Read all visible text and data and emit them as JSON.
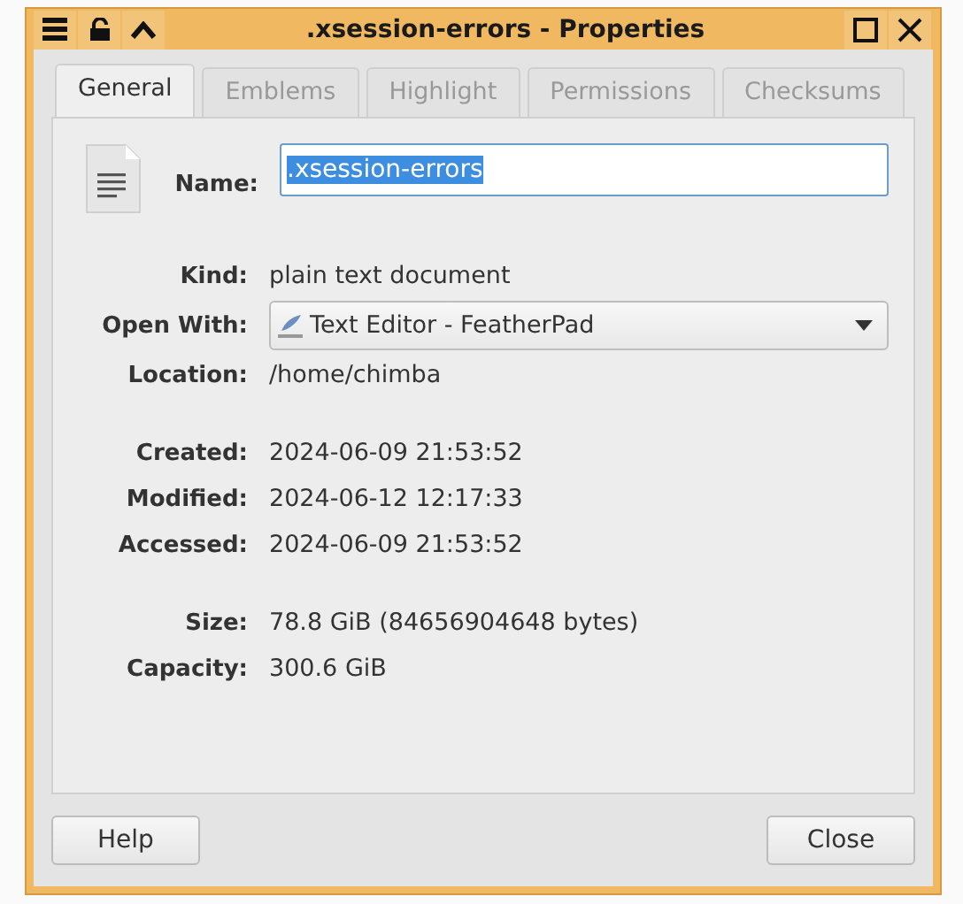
{
  "window": {
    "title": ".xsession-errors - Properties"
  },
  "tabs": [
    {
      "label": "General",
      "selected": true
    },
    {
      "label": "Emblems",
      "selected": false
    },
    {
      "label": "Highlight",
      "selected": false
    },
    {
      "label": "Permissions",
      "selected": false
    },
    {
      "label": "Checksums",
      "selected": false
    }
  ],
  "name_field": {
    "label": "Name:",
    "value": ".xsession-errors",
    "selected": true
  },
  "info_groups": [
    [
      {
        "label": "Kind:",
        "kind": "text",
        "value": "plain text document"
      },
      {
        "label": "Open With:",
        "kind": "dropdown",
        "value": "Text Editor - FeatherPad"
      },
      {
        "label": "Location:",
        "kind": "text",
        "value": "/home/chimba"
      }
    ],
    [
      {
        "label": "Created:",
        "kind": "text",
        "value": "2024-06-09 21:53:52"
      },
      {
        "label": "Modified:",
        "kind": "text",
        "value": "2024-06-12 12:17:33"
      },
      {
        "label": "Accessed:",
        "kind": "text",
        "value": "2024-06-09 21:53:52"
      }
    ],
    [
      {
        "label": "Size:",
        "kind": "text",
        "value": "78.8 GiB (84656904648 bytes)"
      },
      {
        "label": "Capacity:",
        "kind": "text",
        "value": "300.6 GiB"
      }
    ]
  ],
  "buttons": [
    "Help",
    "Close"
  ]
}
